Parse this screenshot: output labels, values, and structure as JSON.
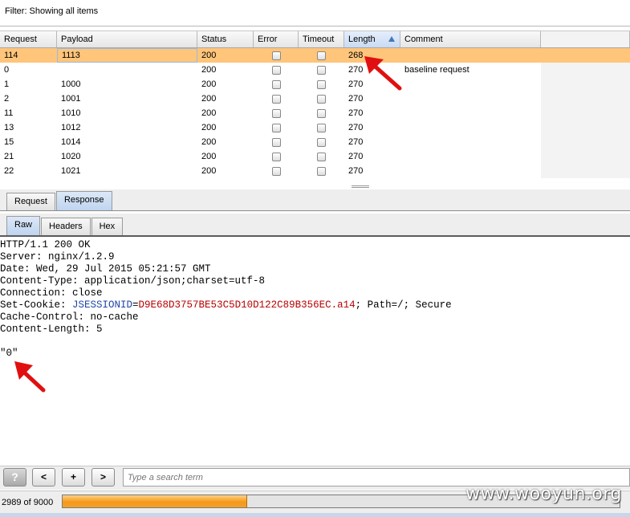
{
  "filter": {
    "label": "Filter: Showing all items"
  },
  "table": {
    "columns": [
      "Request",
      "Payload",
      "Status",
      "Error",
      "Timeout",
      "Length",
      "Comment"
    ],
    "rows": [
      {
        "request": "114",
        "payload": "1113",
        "status": "200",
        "length": "268",
        "comment": "",
        "selected": true
      },
      {
        "request": "0",
        "payload": "",
        "status": "200",
        "length": "270",
        "comment": "baseline request"
      },
      {
        "request": "1",
        "payload": "1000",
        "status": "200",
        "length": "270",
        "comment": ""
      },
      {
        "request": "2",
        "payload": "1001",
        "status": "200",
        "length": "270",
        "comment": ""
      },
      {
        "request": "11",
        "payload": "1010",
        "status": "200",
        "length": "270",
        "comment": ""
      },
      {
        "request": "13",
        "payload": "1012",
        "status": "200",
        "length": "270",
        "comment": ""
      },
      {
        "request": "15",
        "payload": "1014",
        "status": "200",
        "length": "270",
        "comment": ""
      },
      {
        "request": "21",
        "payload": "1020",
        "status": "200",
        "length": "270",
        "comment": ""
      },
      {
        "request": "22",
        "payload": "1021",
        "status": "200",
        "length": "270",
        "comment": ""
      }
    ]
  },
  "tabs": {
    "request": "Request",
    "response": "Response"
  },
  "subtabs": {
    "raw": "Raw",
    "headers": "Headers",
    "hex": "Hex"
  },
  "response": {
    "status_line": "HTTP/1.1 200 OK",
    "server": "Server: nginx/1.2.9",
    "date": "Date: Wed, 29 Jul 2015 05:21:57 GMT",
    "content_type": "Content-Type: application/json;charset=utf-8",
    "connection": "Connection: close",
    "cookie_prefix": "Set-Cookie: ",
    "cookie_name": "JSESSIONID",
    "cookie_eq": "=",
    "cookie_value": "D9E68D3757BE53C5D10D122C89B356EC.a14",
    "cookie_suffix": "; Path=/; Secure",
    "cache_control": "Cache-Control: no-cache",
    "content_length": "Content-Length: 5",
    "body": "\"0\""
  },
  "search": {
    "help": "?",
    "prev": "<",
    "add": "+",
    "next": ">",
    "placeholder": "Type a search term"
  },
  "status": {
    "progress_text": "2989 of 9000",
    "progress_fraction": 0.3321,
    "watermark": "www.wooyun.org"
  },
  "colors": {
    "selected_row": "#ffc57a",
    "progress": "#f59a16",
    "annotation_arrow": "#e01010"
  }
}
